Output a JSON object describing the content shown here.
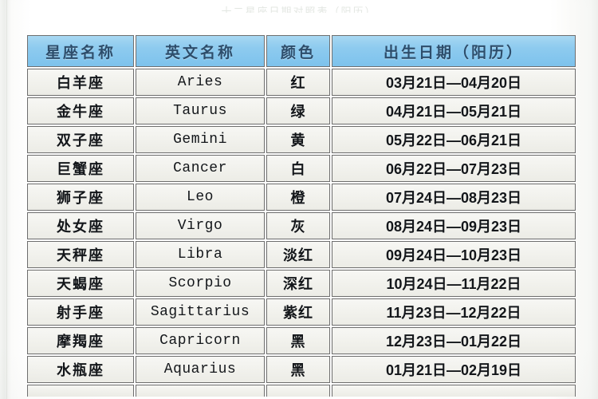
{
  "page": {
    "top_clipped_text": "十二星座日期对照表（阳历）"
  },
  "table": {
    "headers": [
      {
        "label": "星座名称",
        "name": "zodiac-name"
      },
      {
        "label": "英文名称",
        "name": "english-name"
      },
      {
        "label": "颜色",
        "name": "color"
      },
      {
        "label": "出生日期（阳历）",
        "name": "birth-date"
      }
    ],
    "rows": [
      {
        "name": "白羊座",
        "english": "Aries",
        "color": "红",
        "date": "03月21日—04月20日"
      },
      {
        "name": "金牛座",
        "english": "Taurus",
        "color": "绿",
        "date": "04月21日—05月21日"
      },
      {
        "name": "双子座",
        "english": "Gemini",
        "color": "黄",
        "date": "05月22日—06月21日"
      },
      {
        "name": "巨蟹座",
        "english": "Cancer",
        "color": "白",
        "date": "06月22日—07月23日"
      },
      {
        "name": "狮子座",
        "english": "Leo",
        "color": "橙",
        "date": "07月24日—08月23日"
      },
      {
        "name": "处女座",
        "english": "Virgo",
        "color": "灰",
        "date": "08月24日—09月23日"
      },
      {
        "name": "天秤座",
        "english": "Libra",
        "color": "淡红",
        "date": "09月24日—10月23日"
      },
      {
        "name": "天蝎座",
        "english": "Scorpio",
        "color": "深红",
        "date": "10月24日—11月22日"
      },
      {
        "name": "射手座",
        "english": "Sagittarius",
        "color": "紫红",
        "date": "11月23日—12月22日"
      },
      {
        "name": "摩羯座",
        "english": "Capricorn",
        "color": "黑",
        "date": "12月23日—01月22日"
      },
      {
        "name": "水瓶座",
        "english": "Aquarius",
        "color": "黑",
        "date": "01月21日—02月19日"
      }
    ],
    "clipped_row_visible": true
  },
  "colors": {
    "header_blue": "#8ecbef",
    "header_blue_light": "#a8d8f2",
    "header_text": "#2d4d6b",
    "cell_background": "#f3f3ee",
    "border": "#6d6d6d",
    "page_background": "#ffffff"
  }
}
